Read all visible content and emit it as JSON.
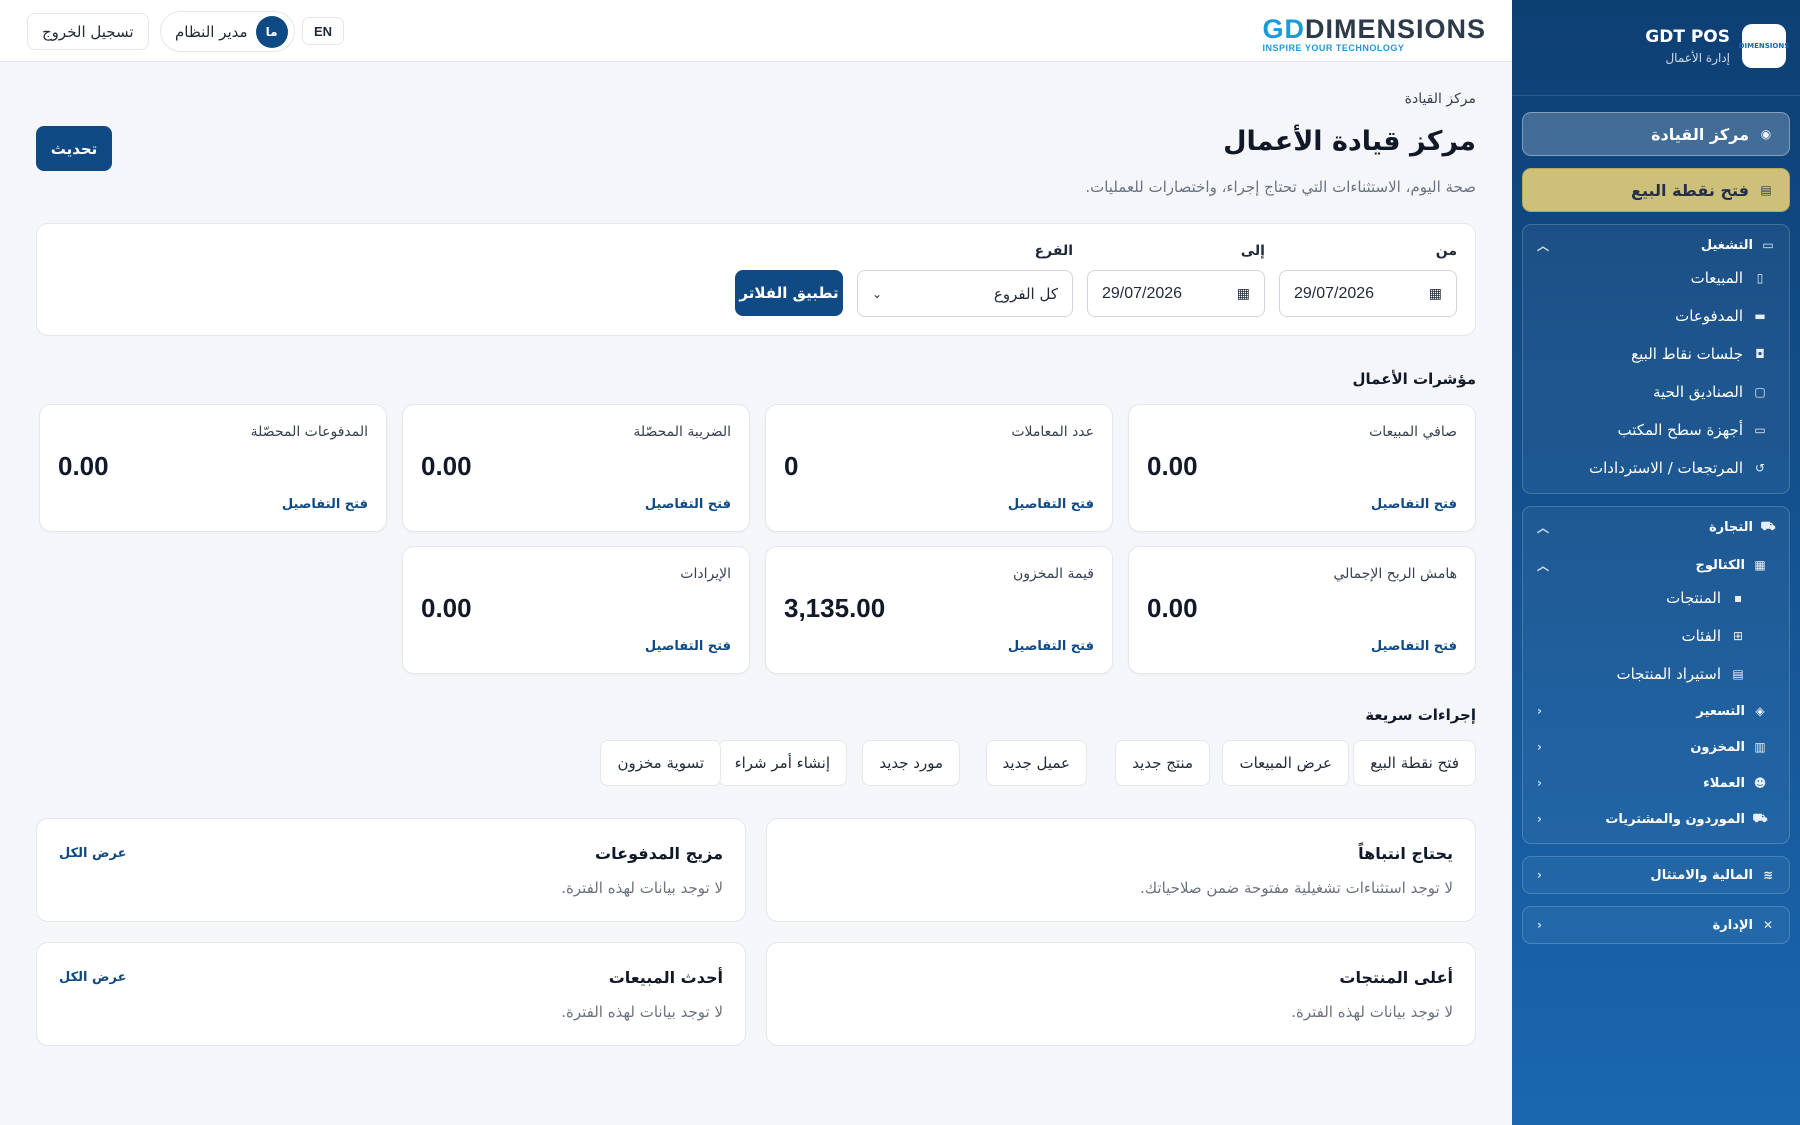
{
  "brand": {
    "name": "GDT POS",
    "subtitle": "إدارة الأعمال",
    "logo_text": "DIMENSIONS",
    "logo_tagline": "INSPIRE YOUR TECHNOLOGY"
  },
  "header": {
    "logout": "تسجيل الخروج",
    "user_name": "مدير النظام",
    "user_initials": "ما",
    "lang": "EN"
  },
  "sidebar": {
    "command_center": "مركز القيادة",
    "open_pos": "فتح نقطة البيع",
    "operations": {
      "title": "التشغيل",
      "items": [
        "المبيعات",
        "المدفوعات",
        "جلسات نقاط البيع",
        "الصناديق الحية",
        "أجهزة سطح المكتب",
        "المرتجعات / الاستردادات"
      ]
    },
    "commerce": {
      "title": "التجارة",
      "catalog": {
        "title": "الكتالوج",
        "items": [
          "المنتجات",
          "الفئات",
          "استيراد المنتجات"
        ]
      },
      "collapsed": [
        "التسعير",
        "المخزون",
        "العملاء",
        "الموردون والمشتريات"
      ]
    },
    "finance": "المالية والامتثال",
    "admin": "الإدارة"
  },
  "page": {
    "breadcrumb": "مركز القيادة",
    "title": "مركز قيادة الأعمال",
    "description": "صحة اليوم، الاستثناءات التي تحتاج إجراء، واختصارات للعمليات.",
    "refresh": "تحديث"
  },
  "filters": {
    "from_label": "من",
    "from_value": "29/07/2026",
    "to_label": "إلى",
    "to_value": "29/07/2026",
    "branch_label": "الفرع",
    "branch_value": "كل الفروع",
    "apply": "تطبيق الفلاتر"
  },
  "kpis": {
    "title": "مؤشرات الأعمال",
    "link": "فتح التفاصيل",
    "items": [
      {
        "label": "صافي المبيعات",
        "value": "0.00"
      },
      {
        "label": "عدد المعاملات",
        "value": "0"
      },
      {
        "label": "الضريبة المحصّلة",
        "value": "0.00"
      },
      {
        "label": "المدفوعات المحصّلة",
        "value": "0.00"
      },
      {
        "label": "هامش الربح الإجمالي",
        "value": "0.00"
      },
      {
        "label": "قيمة المخزون",
        "value": "3,135.00"
      },
      {
        "label": "الإيرادات",
        "value": "0.00"
      }
    ]
  },
  "quick_actions": {
    "title": "إجراءات سريعة",
    "items": [
      "فتح نقطة البيع",
      "عرض المبيعات",
      "منتج جديد",
      "عميل جديد",
      "مورد جديد",
      "إنشاء أمر شراء",
      "تسوية مخزون"
    ]
  },
  "panels": {
    "attention": {
      "title": "يحتاج انتباهاً",
      "empty": "لا توجد استثناءات تشغيلية مفتوحة ضمن صلاحياتك."
    },
    "payment_mix": {
      "title": "مزيج المدفوعات",
      "empty": "لا توجد بيانات لهذه الفترة.",
      "link": "عرض الكل"
    },
    "top_products": {
      "title": "أعلى المنتجات",
      "empty": "لا توجد بيانات لهذه الفترة."
    },
    "recent_sales": {
      "title": "أحدث المبيعات",
      "empty": "لا توجد بيانات لهذه الفترة.",
      "link": "عرض الكل"
    }
  },
  "icons": {
    "dashboard": "gauge-icon",
    "pos": "register-icon",
    "chevron": "chevron-icon"
  },
  "colors": {
    "primary": "#0f4a85",
    "sidebar_top": "#0d3f73",
    "sidebar_bottom": "#1a67b0",
    "pos_button": "#e2cd78"
  }
}
